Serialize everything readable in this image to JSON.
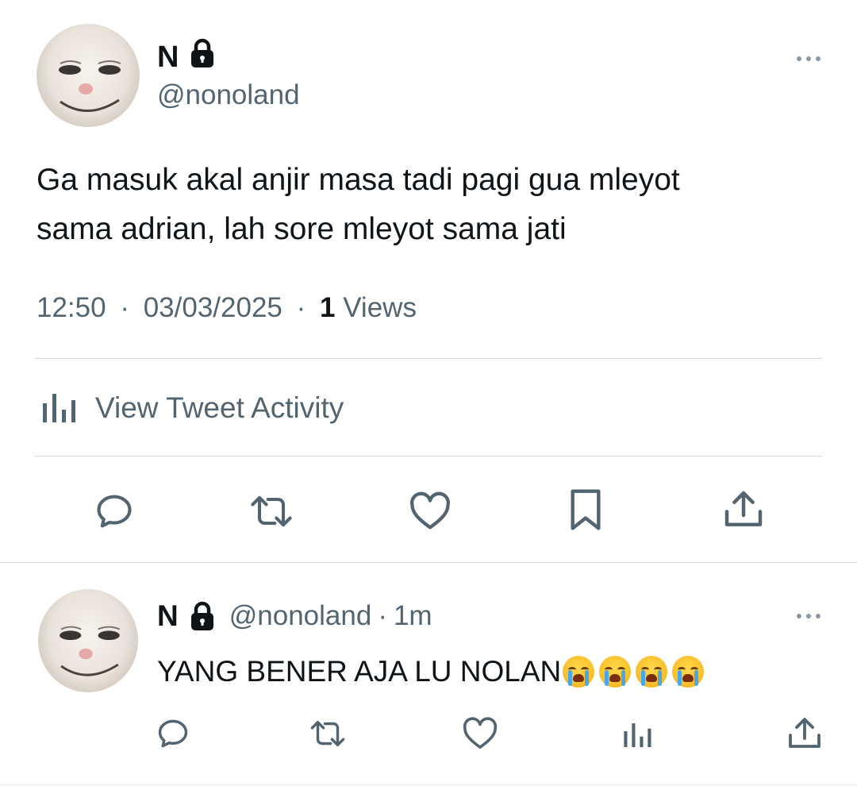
{
  "main_tweet": {
    "display_name": "N",
    "handle": "@nonoland",
    "text_line1": "Ga masuk akal anjir masa tadi pagi gua mleyot",
    "text_line2": "sama adrian, lah sore mleyot sama jati",
    "time": "12:50",
    "date": "03/03/2025",
    "views_count": "1",
    "views_label": "Views",
    "separator": "·",
    "activity_label": "View Tweet Activity"
  },
  "reply": {
    "display_name": "N",
    "handle": "@nonoland",
    "separator": "·",
    "age": "1m",
    "text": "YANG BENER AJA LU NOLAN",
    "emoji_count": 4
  },
  "icons": {
    "lock": "lock-icon",
    "more": "more-icon",
    "reply": "reply-icon",
    "retweet": "retweet-icon",
    "like": "like-icon",
    "bookmark": "bookmark-icon",
    "share": "share-icon",
    "analytics": "analytics-icon"
  },
  "colors": {
    "text": "#0f1419",
    "muted": "#536471",
    "divider": "#cfd9de"
  }
}
